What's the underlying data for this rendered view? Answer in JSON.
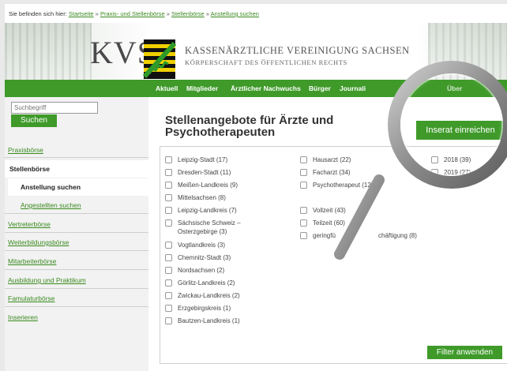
{
  "breadcrumb": {
    "prefix": "Sie befinden sich hier:",
    "items": [
      "Startseite",
      "Praxis- und Stellenbörse",
      "Stellenbörse",
      "Anstellung suchen"
    ],
    "separator": "»"
  },
  "header": {
    "logo_text": "KVS",
    "org_name": "KASSENÄRZTLICHE VEREINIGUNG SACHSEN",
    "org_subtitle": "KÖRPERSCHAFT DES ÖFFENTLICHEN RECHTS"
  },
  "nav": {
    "items": [
      "Aktuell",
      "Mitglieder",
      "Ärztlicher Nachwuchs",
      "Bürger",
      "Journali",
      "Über"
    ]
  },
  "sidebar": {
    "search_placeholder": "Suchbegriff",
    "search_button": "Suchen",
    "items": {
      "praxisboerse": "Praxisbörse",
      "stellenboerse": "Stellenbörse",
      "anstellung": "Anstellung suchen",
      "angestellten": "Angestellten suchen",
      "vertreter": "Vertreterbörse",
      "weiterbildung": "Weiterbildungsbörse",
      "mitarbeiter": "Mitarbeiterbörse",
      "ausbildung": "Ausbildung und Praktikum",
      "famulatur": "Famulaturbörse",
      "inserieren": "Inserieren"
    }
  },
  "main": {
    "title_line1": "Stellenangebote für Ärzte und",
    "title_line2": "Psychotherapeuten",
    "inserat_button": "Inserat einreichen",
    "apply_button": "Filter anwenden",
    "regions": [
      "Leipzig-Stadt (17)",
      "Dresden-Stadt (11)",
      "Meißen-Landkreis (9)",
      "Mittelsachsen (8)",
      "Leipzig-Landkreis (7)",
      "Sächsische Schweiz –",
      "Osterzgebirge (3)",
      "Vogtlandkreis (3)",
      "Chemnitz-Stadt (3)",
      "Nordsachsen (2)",
      "Görlitz-Landkreis (2)",
      "Zwickau-Landkreis (2)",
      "Erzgebirgskreis (1)",
      "Bautzen-Landkreis (1)"
    ],
    "types": [
      "Hausarzt (22)",
      "Facharzt (34)",
      "Psychotherapeut (12)"
    ],
    "worktime": [
      "Vollzeit (43)",
      "Teilzeit (60)",
      "geringfü",
      "chäftigung (8)"
    ],
    "years": [
      "2018 (39)",
      "2019 (27)"
    ]
  },
  "colors": {
    "brand_green": "#3f9a2a",
    "link_green": "#3a8a1e"
  }
}
